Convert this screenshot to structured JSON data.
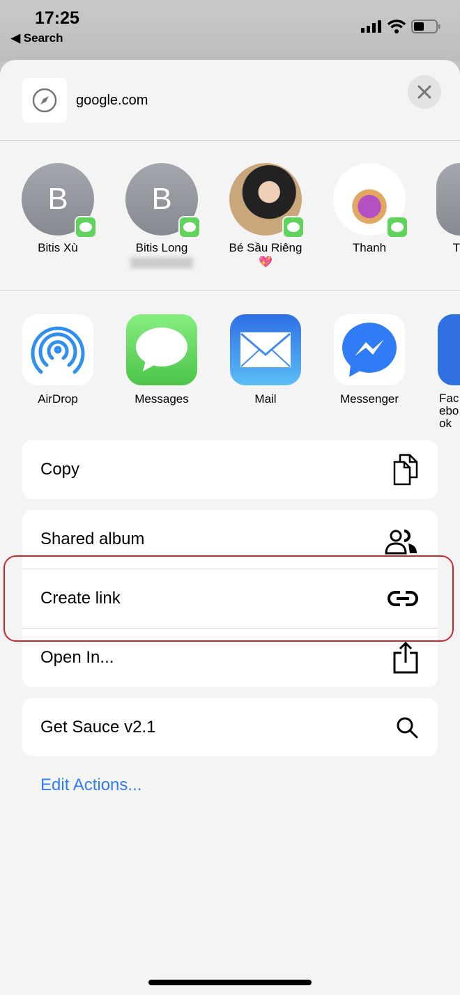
{
  "status_bar": {
    "time": "17:25",
    "back_label": "Search",
    "battery_level": 0.45
  },
  "header": {
    "title": "google.com",
    "icon": "safari-compass-icon",
    "close_icon": "close-icon"
  },
  "contacts": [
    {
      "name": "Bitis Xù",
      "initial": "B",
      "sub": ""
    },
    {
      "name": "Bitis Long",
      "initial": "B",
      "sub": ""
    },
    {
      "name": "Bé Sầu Riêng",
      "initial": "",
      "sub": "💖"
    },
    {
      "name": "Thanh",
      "initial": "",
      "sub": ""
    },
    {
      "name": "T",
      "initial": "",
      "sub": ""
    }
  ],
  "apps": [
    {
      "name": "AirDrop",
      "icon": "airdrop-icon"
    },
    {
      "name": "Messages",
      "icon": "messages-icon"
    },
    {
      "name": "Mail",
      "icon": "mail-icon"
    },
    {
      "name": "Messenger",
      "icon": "messenger-icon"
    },
    {
      "name": "Facebook",
      "icon": "facebook-icon"
    }
  ],
  "actions": {
    "copy": "Copy",
    "shared_album": "Shared album",
    "create_link": "Create link",
    "open_in": "Open In...",
    "get_sauce": "Get Sauce v2.1",
    "edit_actions": "Edit Actions..."
  },
  "colors": {
    "accent": "#2f7cf6",
    "highlight": "#c9282c",
    "badge": "#5fd35c"
  }
}
